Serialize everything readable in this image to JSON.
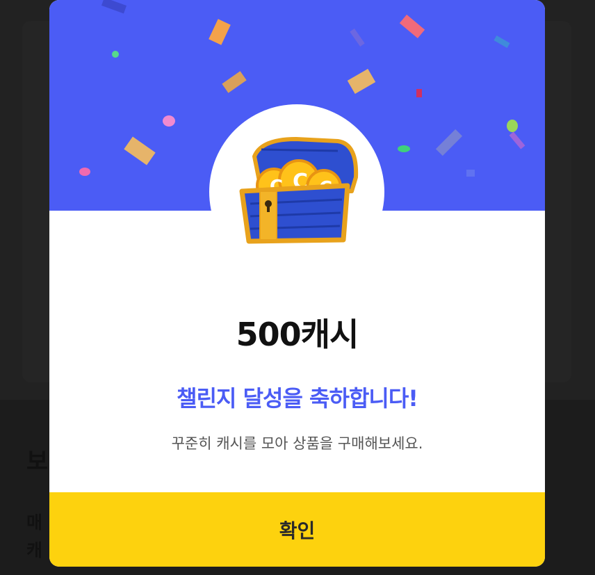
{
  "reward": {
    "amount": "500캐시",
    "title": "챌린지 달성을 축하합니다!",
    "description": "꾸준히 캐시를 모아 상품을 구매해보세요.",
    "confirm_label": "확인"
  },
  "background": {
    "heading_fragment": "보",
    "line1_fragment": "매",
    "line2_fragment": "캐"
  },
  "colors": {
    "accent": "#4b5cf5",
    "button": "#fdd20e",
    "overlay": "#202020"
  },
  "icons": {
    "illustration": "treasure-chest-icon"
  }
}
